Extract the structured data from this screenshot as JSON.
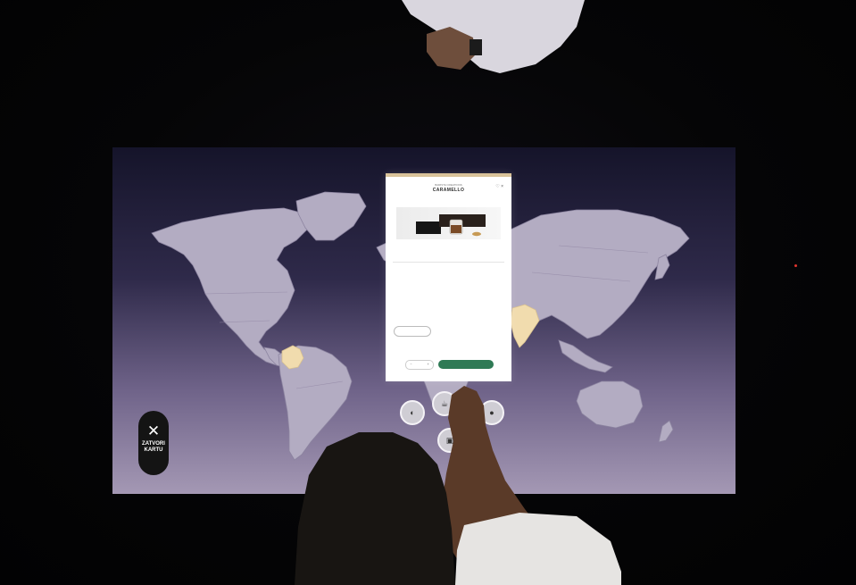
{
  "close_button": {
    "icon": "close-icon",
    "label_line1": "ZATVORI",
    "label_line2": "KARTU"
  },
  "product_card": {
    "kicker": "BARISTA CREATIONS",
    "title": "CARAMELLO",
    "subtitle": "",
    "meta_left": "",
    "meta_center": "",
    "meta_right": "",
    "attributes": [],
    "description": "",
    "secondary_button": "",
    "price": "",
    "price_note": "",
    "quantity": "",
    "add_to_cart": "",
    "colors": {
      "accent": "#2f7a55",
      "topbar": "#d9c39a"
    }
  },
  "map": {
    "highlighted_countries": [
      "Colombia",
      "India"
    ],
    "colors": {
      "land": "#b3acc2",
      "origin": "#f1dcae"
    }
  },
  "bubbles": [
    {
      "name": "capsule-bubble",
      "icon": "capsule-icon"
    },
    {
      "name": "cup-bubble",
      "icon": "cup-icon"
    },
    {
      "name": "bean-bubble",
      "icon": "bean-icon"
    },
    {
      "name": "info-bubble",
      "icon": "info-icon"
    }
  ]
}
